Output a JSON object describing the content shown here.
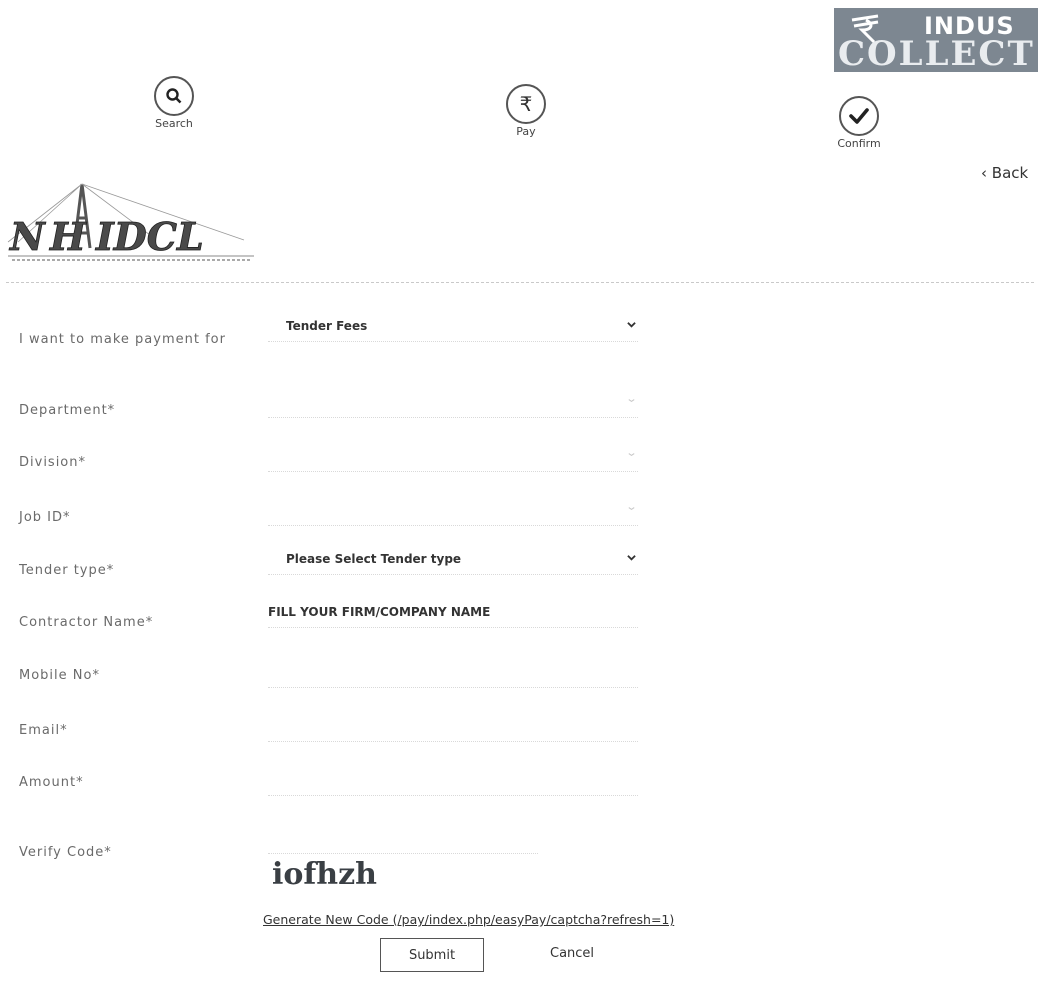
{
  "brand": {
    "line1": "INDUS",
    "line2": "COLLECT",
    "icon": "rupee-mark-icon"
  },
  "steps": [
    {
      "label": "Search",
      "icon": "search-icon"
    },
    {
      "label": "Pay",
      "icon": "rupee-icon"
    },
    {
      "label": "Confirm",
      "icon": "check-icon"
    }
  ],
  "nav": {
    "back_label": "Back"
  },
  "org_logo": {
    "name": "NHIDCL",
    "icon": "nhidcl-logo"
  },
  "form": {
    "payment_for": {
      "label": "I want to make payment for",
      "value": "Tender Fees"
    },
    "department": {
      "label": "Department*",
      "value": ""
    },
    "division": {
      "label": "Division*",
      "value": ""
    },
    "job_id": {
      "label": "Job ID*",
      "value": ""
    },
    "tender_type": {
      "label": "Tender type*",
      "value": "Please Select Tender type"
    },
    "contractor_name": {
      "label": "Contractor Name*",
      "value": "FILL YOUR FIRM/COMPANY NAME"
    },
    "mobile": {
      "label": "Mobile No*",
      "value": ""
    },
    "email": {
      "label": "Email*",
      "value": ""
    },
    "amount": {
      "label": "Amount*",
      "value": ""
    },
    "verify": {
      "label": "Verify Code*",
      "captcha_text": "iofhzh",
      "generate_link": "Generate New Code (/pay/index.php/easyPay/captcha?refresh=1)"
    }
  },
  "actions": {
    "submit": "Submit",
    "cancel": "Cancel"
  },
  "colors": {
    "brand_bg": "#7d8791",
    "text": "#6a6a6a"
  }
}
